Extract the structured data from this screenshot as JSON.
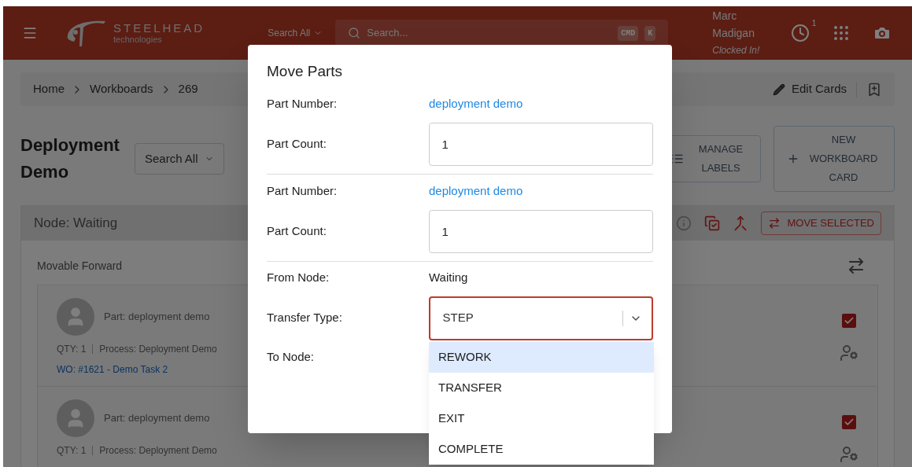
{
  "header": {
    "logo": {
      "name": "STEELHEAD",
      "tagline": "technologies"
    },
    "search_scope": "Search All",
    "search": {
      "placeholder": "Search..."
    },
    "shortcut_keys": [
      "CMD",
      "K"
    ],
    "user": {
      "name": "Marc Madigan",
      "status": "Clocked In!"
    },
    "clock_badge": "1"
  },
  "breadcrumb": {
    "items": [
      "Home",
      "Workboards",
      "269"
    ],
    "edit_cards": "Edit Cards"
  },
  "page": {
    "title": "Deployment Demo",
    "search_scope": "Search All",
    "buttons": [
      {
        "kind": "labels",
        "label": "MANAGE LABELS"
      },
      {
        "kind": "add",
        "label": "NEW WORKBOARD CARD"
      }
    ]
  },
  "node": {
    "title": "Node: Waiting",
    "move_selected": "MOVE SELECTED",
    "section": "Movable Forward",
    "cards": [
      {
        "part": "Part: deployment demo",
        "qty": "QTY: 1",
        "process": "Process: Deployment Demo",
        "work_order": "WO: #1621 - Demo Task 2",
        "checked": true
      },
      {
        "part": "Part: deployment demo",
        "qty": "QTY: 1",
        "process": "Process: Deployment Demo",
        "checked": true
      }
    ]
  },
  "modal": {
    "title": "Move Parts",
    "parts": [
      {
        "number_label": "Part Number:",
        "number": "deployment demo",
        "count_label": "Part Count:",
        "count": "1"
      },
      {
        "number_label": "Part Number:",
        "number": "deployment demo",
        "count_label": "Part Count:",
        "count": "1"
      }
    ],
    "from_label": "From Node:",
    "from_value": "Waiting",
    "transfer_label": "Transfer Type:",
    "transfer_value": "STEP",
    "to_label": "To Node:",
    "options": [
      {
        "label": "REWORK",
        "selected": true
      },
      {
        "label": "TRANSFER",
        "selected": false
      },
      {
        "label": "EXIT",
        "selected": false
      },
      {
        "label": "COMPLETE",
        "selected": false
      }
    ]
  }
}
